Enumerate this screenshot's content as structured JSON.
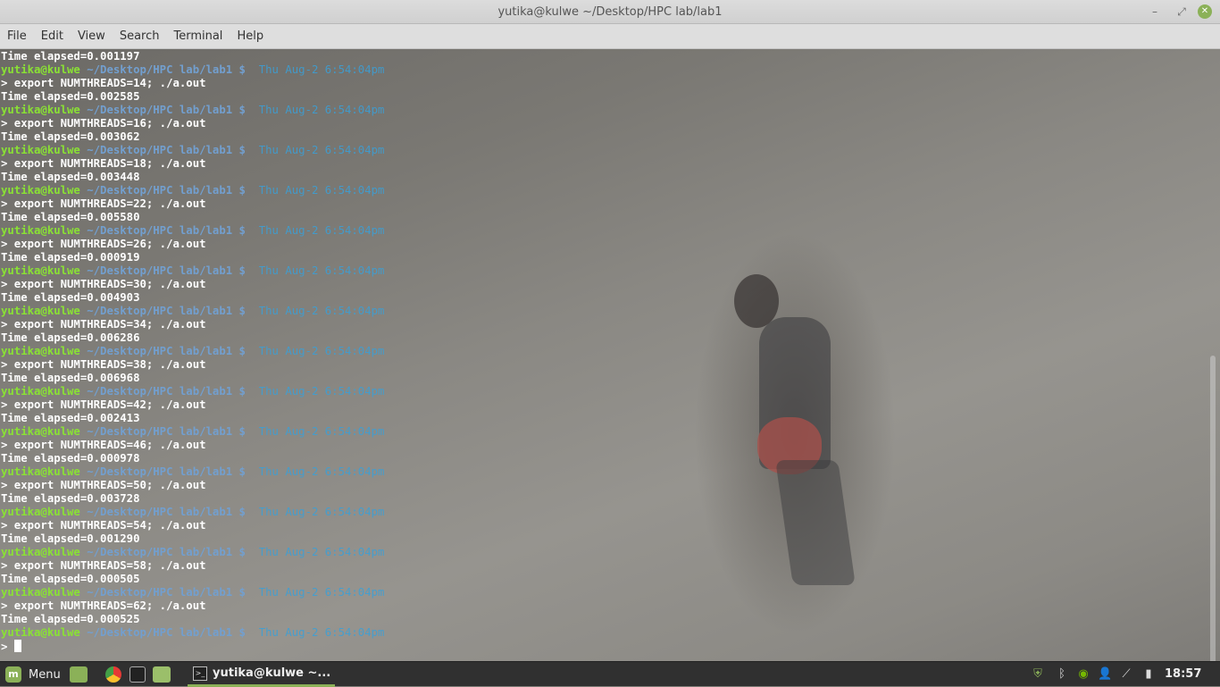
{
  "window": {
    "title": "yutika@kulwe ~/Desktop/HPC lab/lab1",
    "controls": {
      "minimize": "–",
      "maximize": "⤢",
      "close": "✕"
    }
  },
  "menu": [
    "File",
    "Edit",
    "View",
    "Search",
    "Terminal",
    "Help"
  ],
  "terminal": {
    "user": "yutika@kulwe",
    "path": "~/Desktop/HPC lab/lab1 $",
    "date": "Thu Aug-2 6:54:04pm",
    "first_output": "Time elapsed=0.001197",
    "runs": [
      {
        "cmd": "> export NUMTHREADS=14; ./a.out",
        "out": "Time elapsed=0.002585"
      },
      {
        "cmd": "> export NUMTHREADS=16; ./a.out",
        "out": "Time elapsed=0.003062"
      },
      {
        "cmd": "> export NUMTHREADS=18; ./a.out",
        "out": "Time elapsed=0.003448"
      },
      {
        "cmd": "> export NUMTHREADS=22; ./a.out",
        "out": "Time elapsed=0.005580"
      },
      {
        "cmd": "> export NUMTHREADS=26; ./a.out",
        "out": "Time elapsed=0.000919"
      },
      {
        "cmd": "> export NUMTHREADS=30; ./a.out",
        "out": "Time elapsed=0.004903"
      },
      {
        "cmd": "> export NUMTHREADS=34; ./a.out",
        "out": "Time elapsed=0.006286"
      },
      {
        "cmd": "> export NUMTHREADS=38; ./a.out",
        "out": "Time elapsed=0.006968"
      },
      {
        "cmd": "> export NUMTHREADS=42; ./a.out",
        "out": "Time elapsed=0.002413"
      },
      {
        "cmd": "> export NUMTHREADS=46; ./a.out",
        "out": "Time elapsed=0.000978"
      },
      {
        "cmd": "> export NUMTHREADS=50; ./a.out",
        "out": "Time elapsed=0.003728"
      },
      {
        "cmd": "> export NUMTHREADS=54; ./a.out",
        "out": "Time elapsed=0.001290"
      },
      {
        "cmd": "> export NUMTHREADS=58; ./a.out",
        "out": "Time elapsed=0.000505"
      },
      {
        "cmd": "> export NUMTHREADS=62; ./a.out",
        "out": "Time elapsed=0.000525"
      }
    ],
    "current_prompt": ">"
  },
  "taskbar": {
    "menu_label": "Menu",
    "task_label": "yutika@kulwe ~...",
    "clock": "18:57",
    "launchers": [
      "files-icon",
      "chrome-icon",
      "terminal-icon",
      "folder-icon"
    ],
    "tray": [
      "shield-icon",
      "bluetooth-icon",
      "nvidia-icon",
      "user-icon",
      "network-icon",
      "battery-icon"
    ]
  },
  "colors": {
    "prompt_user": "#8ae234",
    "prompt_path": "#729fcf",
    "date": "#3aa0d8",
    "output": "#ffffff",
    "accent": "#8bb158"
  }
}
